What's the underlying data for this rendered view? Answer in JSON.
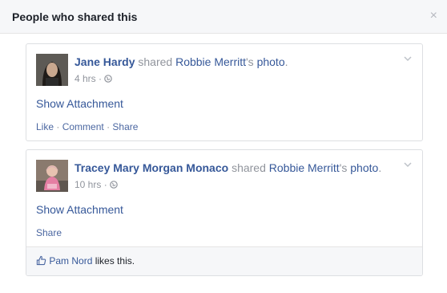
{
  "dialog": {
    "title": "People who shared this",
    "close_glyph": "×"
  },
  "posts": [
    {
      "name": "Jane Hardy",
      "verb": "shared",
      "owner": "Robbie Merritt",
      "owner_suffix": "'s",
      "object": "photo",
      "period": ".",
      "time": "4 hrs",
      "separator": "·",
      "attachment": "Show Attachment",
      "actions": [
        "Like",
        "Comment",
        "Share"
      ]
    },
    {
      "name": "Tracey Mary Morgan Monaco",
      "verb": "shared",
      "owner": "Robbie Merritt",
      "owner_suffix": "'s",
      "object": "photo",
      "period": ".",
      "time": "10 hrs",
      "separator": "·",
      "attachment": "Show Attachment",
      "actions": [
        "Share"
      ],
      "likes": {
        "liker": "Pam Nord",
        "text": "likes this."
      }
    }
  ],
  "colors": {
    "link": "#365899",
    "muted": "#90949c",
    "header_bg": "#f6f7f9"
  }
}
